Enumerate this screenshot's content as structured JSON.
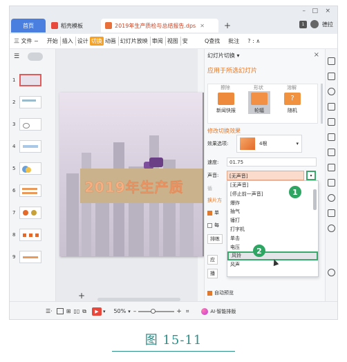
{
  "window": {
    "tabs": [
      {
        "label": "首页"
      },
      {
        "label": "稻壳模板"
      },
      {
        "label": "2019年生产质检与总结报告.dps"
      }
    ],
    "controls": {
      "new_tab": "+",
      "minimize": "–",
      "maximize": "□",
      "close": "×"
    },
    "account_label": "德拉",
    "badge": "1"
  },
  "menubar": {
    "file": "三 文件 ~",
    "items": [
      "开始",
      "插入",
      "设计",
      "切换",
      "动画",
      "幻灯片放映",
      "审阅",
      "视图",
      "安"
    ],
    "active": "切换",
    "search": "Q查找",
    "comment": "批注",
    "more": "?  :  ∧"
  },
  "thumbnails": {
    "numbers": [
      "1",
      "2",
      "3",
      "4",
      "5",
      "6",
      "7",
      "8",
      "9"
    ]
  },
  "slide": {
    "title_text": "2019年生产质",
    "add_icon": "+"
  },
  "pane": {
    "header": "幻灯片切换 ▾",
    "close": "×",
    "apply_title": "应用于所选幻灯片",
    "top_labels": [
      "擦除",
      "形状",
      "溶解"
    ],
    "effects": [
      {
        "label": "新闻快报",
        "color": "#ee8a3c"
      },
      {
        "label": "轮辐",
        "color": "#f29046"
      },
      {
        "label": "随机",
        "color": "#f0923f"
      }
    ],
    "modify_title": "修改切换效果",
    "effect_option_label": "效果选项:",
    "effect_option_value": "4根",
    "speed_label": "速度:",
    "speed_value": "01.75",
    "sound_label": "声音:",
    "sound_value": "[无声音]",
    "sound_options": [
      "[无声音]",
      "[停止前一声音]",
      "爆炸",
      "抽气",
      "锤打",
      "打字机",
      "单击",
      "电压",
      "风铃",
      "风声"
    ],
    "highlighted_option": "风铃",
    "partial_rows": [
      "循",
      "换片方",
      "单",
      "每",
      "排练",
      "应",
      "播"
    ],
    "auto_preview": "自动预览"
  },
  "markers": {
    "one": "1",
    "two": "2"
  },
  "statusbar": {
    "zoom": "50%",
    "minus": "–",
    "plus": "+",
    "ai_label": "AI·智能排版"
  },
  "caption": "图 15-11"
}
